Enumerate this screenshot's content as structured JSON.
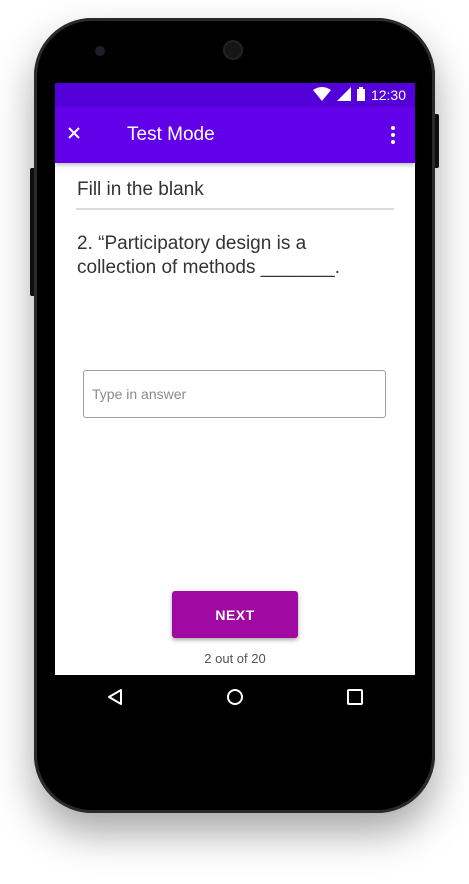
{
  "status_bar": {
    "time": "12:30",
    "icons": [
      "wifi-icon",
      "signal-icon",
      "battery-icon"
    ]
  },
  "app_bar": {
    "title": "Test Mode",
    "close_icon": "close-icon",
    "menu_icon": "more-vert-icon",
    "color": "#6200ea"
  },
  "content": {
    "section_title": "Fill in the blank",
    "question": "2.  “Participatory design is a collection of methods _______.",
    "answer": {
      "value": "",
      "placeholder": "Type in answer"
    },
    "next_label": "NEXT",
    "progress_text": "2 out of 20"
  },
  "nav_bar": {
    "buttons": [
      "back-icon",
      "home-icon",
      "recents-icon"
    ]
  },
  "colors": {
    "status_bar": "#5300d9",
    "app_bar": "#6200ea",
    "next_button": "#a00aa3"
  }
}
